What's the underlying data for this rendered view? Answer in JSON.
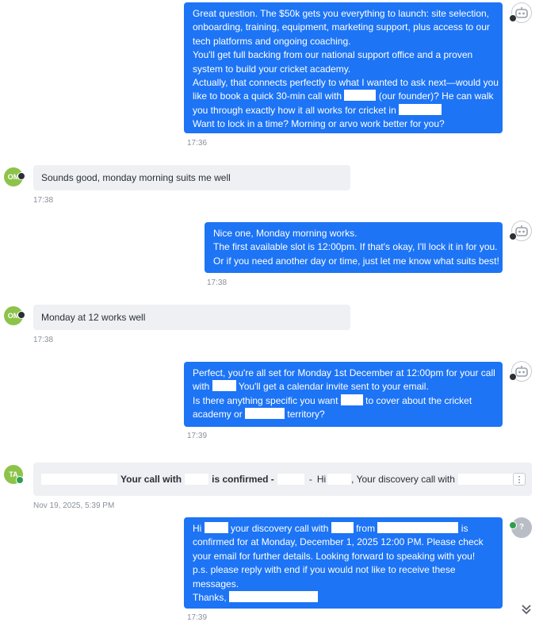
{
  "messages": {
    "m1": {
      "lines": [
        "Great question. The $50k gets you everything to launch: site selection,",
        "onboarding, training, equipment, marketing support, plus access to our",
        "tech platforms and ongoing coaching.",
        "You'll get full backing from our national support office and a proven",
        "system to build your cricket academy.",
        "Actually, that connects perfectly to what I wanted to ask next—would you",
        "like to book a quick 30-min call with",
        "(our founder)? He can walk",
        "you through exactly how it all works for cricket in",
        "Want to lock in a time? Morning or arvo work better for you?"
      ],
      "time": "17:36"
    },
    "m2": {
      "text": "Sounds good, monday morning suits me well",
      "time": "17:38",
      "avatar": "OM"
    },
    "m3": {
      "lines": [
        "Nice one, Monday morning works.",
        "The first available slot is 12:00pm. If that's okay, I'll lock it in for you.",
        "Or if you need another day or time, just let me know what suits best!"
      ],
      "time": "17:38"
    },
    "m4": {
      "text": "Monday at 12 works well",
      "time": "17:38",
      "avatar": "OM"
    },
    "m5": {
      "lines": [
        "Perfect, you're all set for Monday 1st December at 12:00pm for your call",
        "with",
        "You'll get a calendar invite sent to your email.",
        "Is there anything specific you want",
        "to cover about the cricket",
        "academy or",
        "territory?"
      ],
      "time": "17:39"
    },
    "m6": {
      "avatar": "TA",
      "part1": "Your call with",
      "part2": "is confirmed -",
      "dash": "-",
      "hi": "Hi",
      "part3": ", Your discovery call with",
      "menu": "⋮",
      "time": "Nov 19, 2025, 5:39 PM"
    },
    "m7": {
      "l1a": "Hi",
      "l1b": "your discovery call with",
      "l1c": "from",
      "l1d": "is",
      "lines": [
        "confirmed for  at Monday, December 1, 2025 12:00 PM. Please check",
        "your email for further details. Looking forward to speaking with you!",
        "p.s. please reply with end if you would not like to receive these",
        "messages."
      ],
      "thanks": "Thanks,",
      "bot_badge": "?",
      "time": "17:39"
    }
  },
  "icons": {
    "bot": "robot-icon",
    "user_badge": "chat-badge-icon",
    "scroll": "double-chevron-down-icon"
  },
  "colors": {
    "outgoing_bubble": "#1d74f5",
    "incoming_bubble": "#eef0f3",
    "avatar_green": "#8dc34a"
  }
}
